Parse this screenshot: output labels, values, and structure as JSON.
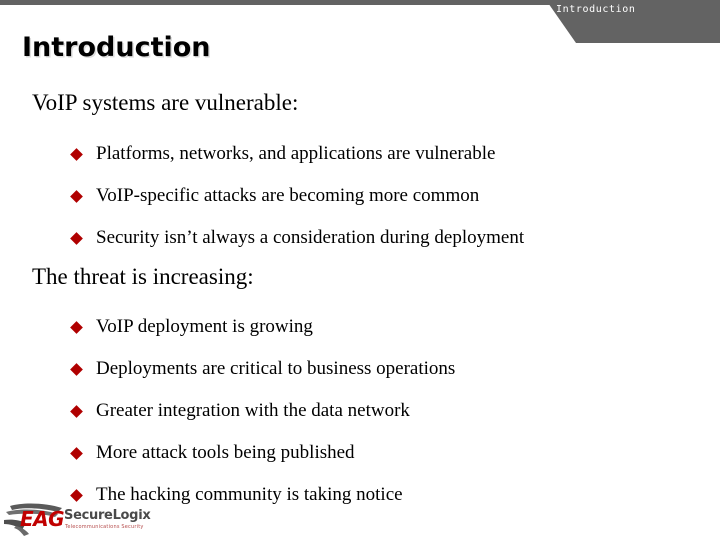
{
  "slide": {
    "title": "Introduction",
    "banner_label": "Introduction",
    "accent_color": "#b00000",
    "banner_color": "#636363",
    "background_color": "#ffffff"
  },
  "sections": [
    {
      "heading": "VoIP systems are vulnerable:",
      "bullets": [
        "Platforms, networks, and applications are vulnerable",
        "VoIP-specific attacks are becoming more common",
        "Security isn’t always a consideration during deployment"
      ]
    },
    {
      "heading": "The threat is increasing:",
      "bullets": [
        "VoIP deployment is growing",
        "Deployments are critical to business operations",
        "Greater integration with the data network",
        "More attack tools being published",
        "The hacking community is taking notice"
      ]
    }
  ],
  "logo": {
    "mark": "EAG",
    "wordmark": "SecureLogix",
    "tagline": "Telecommunications Security",
    "mark_color": "#c00000",
    "wordmark_color": "#4a4a4a"
  }
}
